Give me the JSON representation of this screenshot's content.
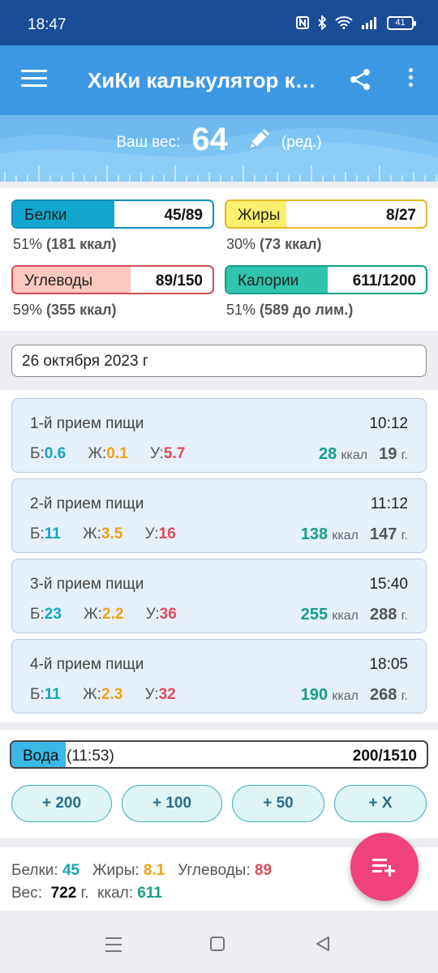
{
  "status_bar": {
    "time": "18:47",
    "battery": "41"
  },
  "app_bar": {
    "title": "ХиКи калькулятор калорий"
  },
  "weight": {
    "label": "Ваш вес:",
    "value": "64",
    "edit_label": "(ред.)"
  },
  "macros": [
    {
      "label": "Белки",
      "value": "45/89",
      "summary": "51%",
      "detail": "(181 ккал)",
      "fraction": 0.51,
      "color": "#12a6cf",
      "border": "#0f8db3"
    },
    {
      "label": "Жиры",
      "value": "8/27",
      "summary": "30%",
      "detail": "(73 ккал)",
      "fraction": 0.3,
      "color": "#fdef6e",
      "border": "#e5b827"
    },
    {
      "label": "Углеводы",
      "value": "89/150",
      "summary": "59%",
      "detail": "(355 ккал)",
      "fraction": 0.59,
      "color": "#fcc8c0",
      "border": "#cf4f55"
    },
    {
      "label": "Калории",
      "value": "611/1200",
      "summary": "51%",
      "detail": "(589 до лим.)",
      "fraction": 0.51,
      "color": "#2fc4ab",
      "border": "#159e88"
    }
  ],
  "date": "26 октября 2023 г",
  "nutrient_letters": {
    "protein": "Б:",
    "fat": "Ж:",
    "carbs": "У:"
  },
  "units": {
    "kcal": "ккал",
    "grams": "г."
  },
  "meals": [
    {
      "name": "1-й прием пищи",
      "time": "10:12",
      "protein": "0.6",
      "fat": "0.1",
      "carbs": "5.7",
      "kcal": "28",
      "grams": "19"
    },
    {
      "name": "2-й прием пищи",
      "time": "11:12",
      "protein": "11",
      "fat": "3.5",
      "carbs": "16",
      "kcal": "138",
      "grams": "147"
    },
    {
      "name": "3-й прием пищи",
      "time": "15:40",
      "protein": "23",
      "fat": "2.2",
      "carbs": "36",
      "kcal": "255",
      "grams": "288"
    },
    {
      "name": "4-й прием пищи",
      "time": "18:05",
      "protein": "11",
      "fat": "2.3",
      "carbs": "32",
      "kcal": "190",
      "grams": "268"
    }
  ],
  "water": {
    "label": "Вода",
    "time": "(11:53)",
    "value": "200/1510",
    "fraction": 0.13,
    "buttons": [
      "+ 200",
      "+ 100",
      "+ 50",
      "+ X"
    ]
  },
  "totals": {
    "protein_label": "Белки:",
    "protein": "45",
    "fat_label": "Жиры:",
    "fat": "8.1",
    "carbs_label": "Углеводы:",
    "carbs": "89",
    "weight_label": "Вес:",
    "weight": "722",
    "weight_unit": "г.",
    "kcal_label": "ккал:",
    "kcal": "611"
  },
  "icons": {
    "menu": "menu-icon",
    "share": "share-icon",
    "more": "more-vert-icon",
    "edit": "pencil-icon",
    "fab": "add-to-list-icon"
  }
}
